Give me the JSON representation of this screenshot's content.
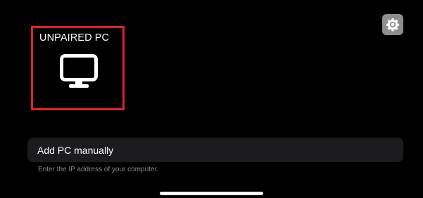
{
  "header": {
    "settings_icon": "gear-icon"
  },
  "computers": [
    {
      "name": "UNPAIRED PC",
      "icon": "monitor-icon",
      "selected": true
    }
  ],
  "add_pc": {
    "label": "Add PC manually",
    "hint": "Enter the IP address of your computer."
  },
  "colors": {
    "background": "#000000",
    "selection_border": "#e0202a",
    "settings_button": "#8e8e8e",
    "row_background": "#1c1c1e",
    "hint_text": "#8a8a8e"
  }
}
